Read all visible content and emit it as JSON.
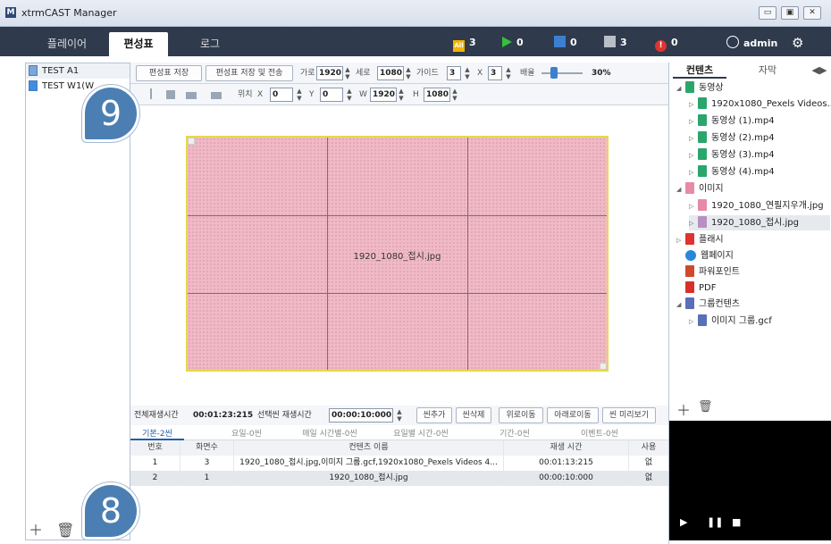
{
  "window": {
    "title": "xtrmCAST Manager",
    "icon": "M"
  },
  "tabs": [
    {
      "label": "플레이어"
    },
    {
      "label": "편성표"
    },
    {
      "label": "로그"
    }
  ],
  "status": {
    "all": "3",
    "play": "0",
    "blue": "0",
    "gray": "3",
    "alert": "0",
    "user": "admin"
  },
  "left_items": [
    {
      "label": "TEST A1"
    },
    {
      "label": "TEST W1(W"
    }
  ],
  "toolbar": {
    "save_label": "편성표 저장",
    "save_send_label": "편성표 저장 및 전송",
    "width_label": "가로",
    "width_value": "1920",
    "height_label": "세로",
    "height_value": "1080",
    "guide_label": "가이드",
    "guide_x": "3",
    "x_label": "X",
    "guide_y": "3",
    "zoom_label": "배율",
    "zoom_value": "30%",
    "pos_label": "위치",
    "posx_label": "X",
    "posx_value": "0",
    "posy_label": "Y",
    "posy_value": "0",
    "w_label": "W",
    "w_value": "1920",
    "h_label": "H",
    "h_value": "1080"
  },
  "stage": {
    "label": "1920_1080_접시.jpg"
  },
  "timebar": {
    "total_label": "전체재생시간",
    "total_value": "00:01:23:215",
    "sel_label": "선택씬 재생시간",
    "sel_value": "00:00:10:000",
    "add": "씬추가",
    "del": "씬삭제",
    "up": "위로이동",
    "down": "아래로이동",
    "preview": "씬 미리보기"
  },
  "subtabs": [
    {
      "label": "기본-2씬"
    },
    {
      "label": "요일-0씬"
    },
    {
      "label": "매일 시간별-0씬"
    },
    {
      "label": "요일별 시간-0씬"
    },
    {
      "label": "기간-0씬"
    },
    {
      "label": "이벤트-0씬"
    }
  ],
  "table": {
    "headers": [
      "번호",
      "화면수",
      "컨텐츠 이름",
      "재생 시간",
      "사용"
    ],
    "rows": [
      [
        "1",
        "3",
        "1920_1080_접시.jpg,이미지 그룹.gcf,1920x1080_Pexels Videos 4...",
        "00:01:13:215",
        "없"
      ],
      [
        "2",
        "1",
        "1920_1080_접시.jpg",
        "00:00:10:000",
        "없"
      ]
    ]
  },
  "right_tabs": [
    {
      "label": "컨텐츠"
    },
    {
      "label": "자막"
    }
  ],
  "tree": [
    {
      "label": "동영상"
    },
    {
      "label": "1920x1080_Pexels Videos..."
    },
    {
      "label": "동영상 (1).mp4"
    },
    {
      "label": "동영상 (2).mp4"
    },
    {
      "label": "동영상 (3).mp4"
    },
    {
      "label": "동영상 (4).mp4"
    },
    {
      "label": "이미지"
    },
    {
      "label": "1920_1080_연필지우개.jpg"
    },
    {
      "label": "1920_1080_접시.jpg"
    },
    {
      "label": "플래시"
    },
    {
      "label": "웹페이지"
    },
    {
      "label": "파워포인트"
    },
    {
      "label": "PDF"
    },
    {
      "label": "그룹컨텐츠"
    },
    {
      "label": "이미지 그룹.gcf"
    }
  ],
  "callouts": {
    "nine": "9",
    "eight": "8"
  }
}
